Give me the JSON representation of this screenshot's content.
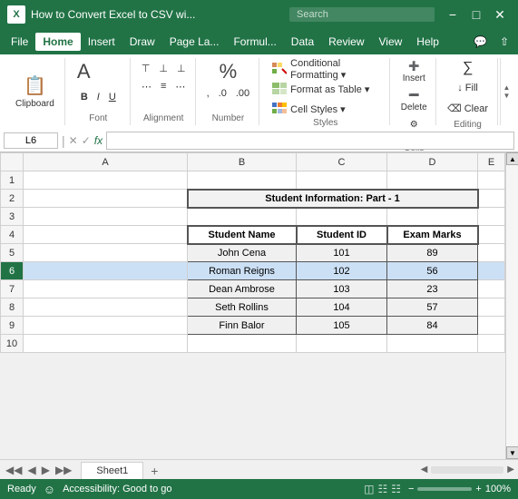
{
  "titleBar": {
    "title": "How to Convert Excel to CSV wi...",
    "searchPlaceholder": "Search",
    "controls": [
      "minimize",
      "maximize",
      "close"
    ]
  },
  "menuBar": {
    "items": [
      "File",
      "Home",
      "Insert",
      "Draw",
      "Page Layout",
      "Formulas",
      "Data",
      "Review",
      "View",
      "Help"
    ],
    "activeItem": "Home",
    "rightIcons": [
      "comment",
      "share"
    ]
  },
  "toolbar": {
    "groups": [
      {
        "name": "Clipboard",
        "label": "Clipboard"
      },
      {
        "name": "Font",
        "label": "Font"
      },
      {
        "name": "Alignment",
        "label": "Alignment"
      },
      {
        "name": "Number",
        "label": "Number"
      }
    ],
    "stylesGroup": {
      "label": "Styles",
      "items": [
        {
          "name": "conditional-formatting",
          "label": "Conditional Formatting"
        },
        {
          "name": "format-as-table",
          "label": "Format as Table"
        },
        {
          "name": "cell-styles",
          "label": "Cell Styles"
        }
      ]
    },
    "cellsGroup": {
      "label": "Cells"
    },
    "editingGroup": {
      "label": "Editing"
    }
  },
  "formulaBar": {
    "cellRef": "L6",
    "formula": ""
  },
  "columns": [
    "",
    "A",
    "B",
    "C",
    "D",
    "E"
  ],
  "rows": [
    {
      "num": 1,
      "cells": [
        "",
        "",
        "",
        "",
        ""
      ]
    },
    {
      "num": 2,
      "cells": [
        "",
        "Student Information: Part - 1",
        "",
        "",
        ""
      ]
    },
    {
      "num": 3,
      "cells": [
        "",
        "",
        "",
        "",
        ""
      ]
    },
    {
      "num": 4,
      "cells": [
        "",
        "Student Name",
        "Student ID",
        "Exam Marks",
        ""
      ]
    },
    {
      "num": 5,
      "cells": [
        "",
        "John Cena",
        "101",
        "89",
        ""
      ]
    },
    {
      "num": 6,
      "cells": [
        "",
        "Roman Reigns",
        "102",
        "56",
        ""
      ]
    },
    {
      "num": 7,
      "cells": [
        "",
        "Dean Ambrose",
        "103",
        "23",
        ""
      ]
    },
    {
      "num": 8,
      "cells": [
        "",
        "Seth Rollins",
        "104",
        "57",
        ""
      ]
    },
    {
      "num": 9,
      "cells": [
        "",
        "Finn Balor",
        "105",
        "84",
        ""
      ]
    },
    {
      "num": 10,
      "cells": [
        "",
        "",
        "",
        "",
        ""
      ]
    }
  ],
  "sheetTabs": {
    "sheets": [
      "Sheet1"
    ],
    "active": "Sheet1"
  },
  "statusBar": {
    "ready": "Ready",
    "accessibility": "Accessibility: Good to go",
    "zoom": "100%",
    "viewIcons": [
      "normal",
      "layout",
      "pagebreak"
    ]
  }
}
